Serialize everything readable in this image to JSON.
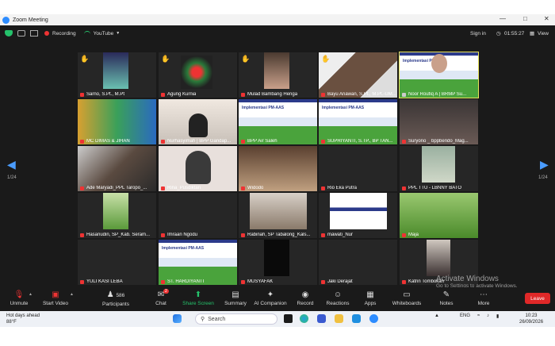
{
  "window": {
    "title": "Zoom Meeting"
  },
  "topbar": {
    "recording": "Recording",
    "youtube": "YouTube",
    "signin": "Sign in",
    "timer": "01:55:27",
    "view": "View"
  },
  "pagination": {
    "left": "1/24",
    "right": "1/24"
  },
  "tiles": [
    {
      "name": "Sarno, S.Pt., M.Pt",
      "hand": true
    },
    {
      "name": "Agung Kurnia",
      "hand": true
    },
    {
      "name": "Mulad Bambang Henga",
      "hand": true
    },
    {
      "name": "Bayu Ariawan, S.Pt., M.Pt.-UM...",
      "hand": true
    },
    {
      "name": "Noor Roufiq A | BRMP Su...",
      "hand": false
    },
    {
      "name": "MC DIMAS & JIHAN",
      "hand": false
    },
    {
      "name": "Nurhasyimah | BPP Gandap...",
      "hand": false
    },
    {
      "name": "BPP Air Saleh",
      "hand": false
    },
    {
      "name": "SUPRIYANTI, S.TP., BP TAN...",
      "hand": false
    },
    {
      "name": "Suryono _ bppbendo_Mag...",
      "hand": false
    },
    {
      "name": "Ade Maryadi_PPL Taropo_...",
      "hand": false
    },
    {
      "name": "Rina_Pusdiktan",
      "hand": false
    },
    {
      "name": "Widodo",
      "hand": false
    },
    {
      "name": "Rio Eka Putra",
      "hand": false
    },
    {
      "name": "PPL TTU - LBNNY BATO",
      "hand": false
    },
    {
      "name": "Hasanudin, SP_Kab. Seram...",
      "hand": false
    },
    {
      "name": "Imraan Ngodu",
      "hand": false
    },
    {
      "name": "Rabinah, SP Tabalong_Kals...",
      "hand": false
    },
    {
      "name": "mawati_Nur",
      "hand": false
    },
    {
      "name": "Maja",
      "hand": false
    },
    {
      "name": "YULI KASI LEBA",
      "hand": false
    },
    {
      "name": "ST. HARDIYANTI",
      "hand": false
    },
    {
      "name": "MUSYAFAK",
      "hand": false
    },
    {
      "name": "Jaki Derajat",
      "hand": false
    },
    {
      "name": "Katrin Tombokan",
      "hand": false
    }
  ],
  "slide_title": "Implementasi PM-AAS",
  "watermark": {
    "line1": "Activate Windows",
    "line2": "Go to Settings to activate Windows."
  },
  "toolbar": {
    "unmute": "Unmute",
    "start_video": "Start Video",
    "participants": "Participants",
    "participants_count": "586",
    "chat": "Chat",
    "chat_badge": "2",
    "share": "Share Screen",
    "summary": "Summary",
    "ai": "AI Companion",
    "record": "Record",
    "reactions": "Reactions",
    "apps": "Apps",
    "whiteboards": "Whiteboards",
    "notes": "Notes",
    "more": "More",
    "leave": "Leave"
  },
  "taskbar": {
    "weather_title": "Hot days ahead",
    "weather_temp": "88°F",
    "search": "Search",
    "lang": "ENG",
    "time": "10:23",
    "date": "26/09/2026"
  }
}
